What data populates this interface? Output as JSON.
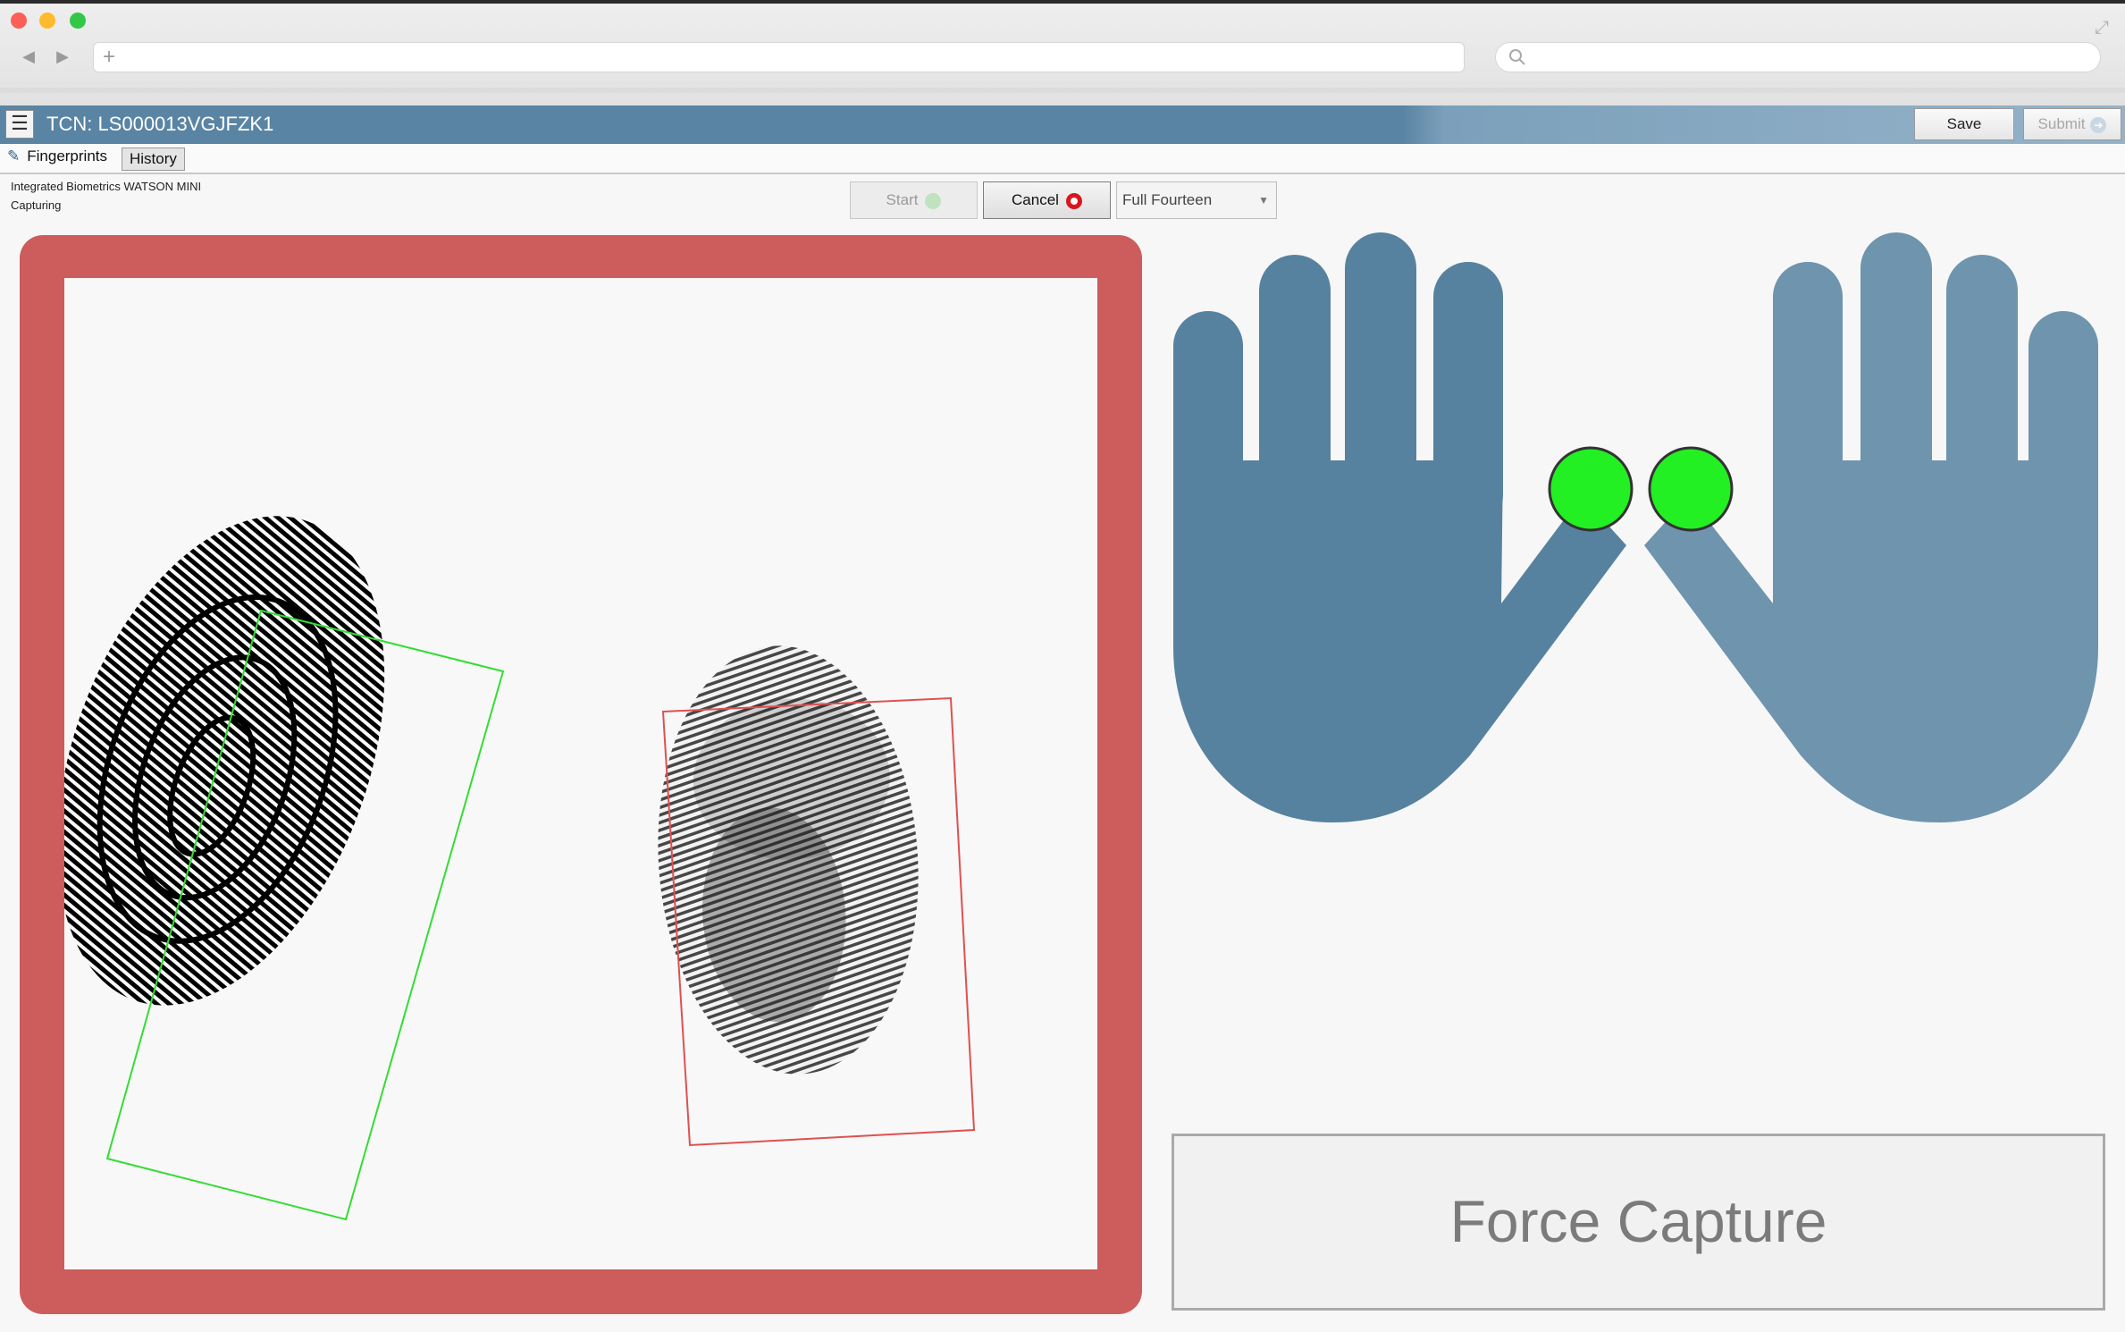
{
  "browser": {
    "new_tab_glyph": "+",
    "back_glyph": "◀",
    "forward_glyph": "▶",
    "expand_glyph": "⤢"
  },
  "header": {
    "menu_glyph": "☰",
    "title": "TCN: LS000013VGJFZK1",
    "save_label": "Save",
    "submit_label": "Submit"
  },
  "tabs": [
    {
      "label": "Fingerprints",
      "active": true
    },
    {
      "label": "History",
      "active": false
    }
  ],
  "device": {
    "name": "Integrated Biometrics WATSON MINI",
    "status": "Capturing"
  },
  "controls": {
    "start_label": "Start",
    "cancel_label": "Cancel",
    "mode_value": "Full Fourteen"
  },
  "capture": {
    "frame_color": "#cd5c5c",
    "prints": [
      {
        "status": "accepted",
        "box_color": "#33dd33"
      },
      {
        "status": "rejected",
        "box_color": "#e05050"
      }
    ]
  },
  "hands": {
    "left_color": "#56829f",
    "right_color": "#6e94ae",
    "highlighted_fingers": [
      "left-thumb",
      "right-thumb"
    ],
    "highlight_color": "#22f022"
  },
  "force_capture_label": "Force Capture",
  "icons": [
    "hamburger-icon",
    "pencil-icon",
    "play-icon",
    "stop-icon",
    "arrow-right-icon",
    "dropdown-arrow-icon",
    "search-icon",
    "plus-icon"
  ]
}
